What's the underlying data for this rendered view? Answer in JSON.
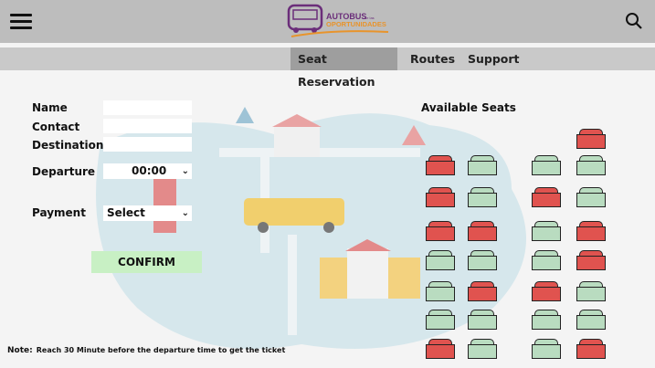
{
  "header": {
    "logo_line1": "AUTOBUS",
    "logo_small": "de las",
    "logo_line2": "OPORTUNIDADES"
  },
  "nav": {
    "tabs": [
      {
        "label": "Seat Reservation",
        "active": true
      },
      {
        "label": "Routes",
        "active": false
      },
      {
        "label": "Support",
        "active": false
      }
    ]
  },
  "form": {
    "name_label": "Name",
    "contact_label": "Contact",
    "destination_label": "Destination",
    "departure_label": "Departure",
    "departure_value": "00:00",
    "payment_label": "Payment",
    "payment_value": "Select",
    "name_value": "",
    "contact_value": "",
    "destination_value": "",
    "confirm_label": "CONFIRM"
  },
  "seats": {
    "title": "Available Seats",
    "colors": {
      "taken": "#e0534f",
      "available": "#b9dcc0"
    },
    "rows": [
      [
        null,
        null,
        null,
        "taken"
      ],
      [
        "taken",
        "available",
        "available",
        "available"
      ],
      [
        "taken",
        "available",
        "taken",
        "available"
      ],
      [
        "taken",
        "taken",
        "available",
        "taken"
      ],
      [
        "available",
        "available",
        "available",
        "taken"
      ],
      [
        "available",
        "taken",
        "taken",
        "available"
      ],
      [
        "available",
        "available",
        "available",
        "available"
      ],
      [
        "taken",
        "available",
        "available",
        "taken"
      ]
    ]
  },
  "note": {
    "label": "Note:",
    "text": "Reach 30 Minute before the departure time to get the ticket"
  }
}
